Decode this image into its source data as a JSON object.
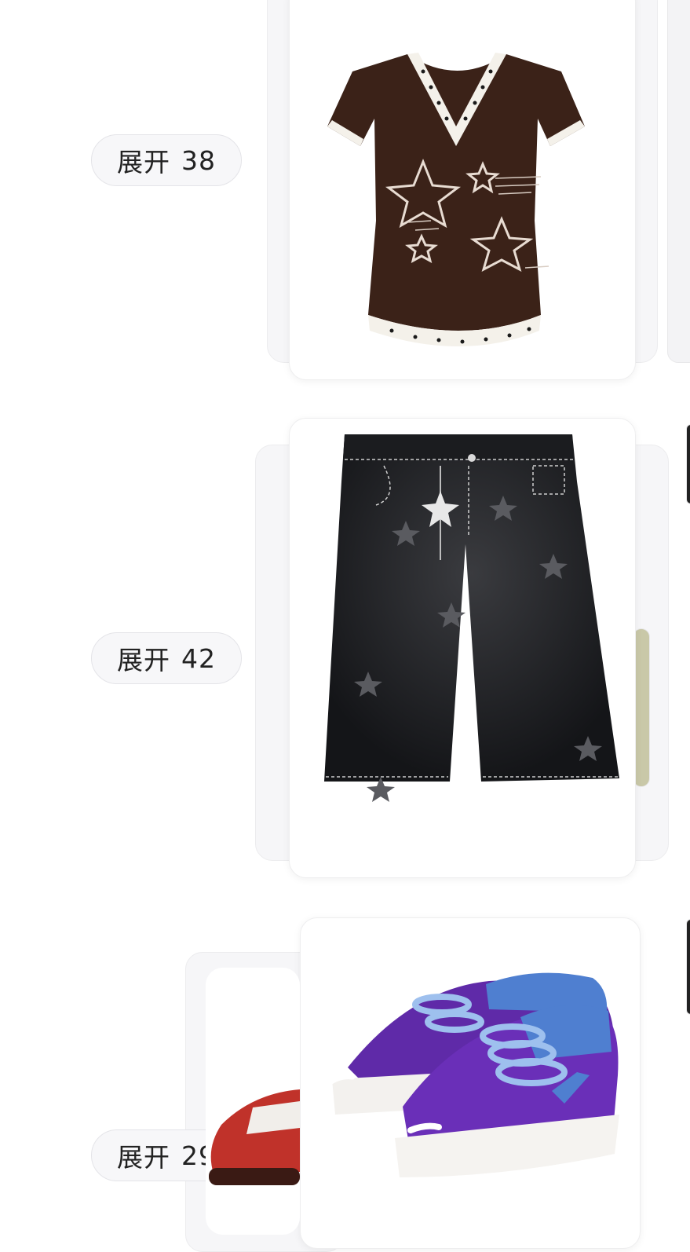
{
  "sections": [
    {
      "expand": {
        "label": "展开",
        "count": "38"
      },
      "product_icon": "brown-v-neck-star-tshirt-icon"
    },
    {
      "expand": {
        "label": "展开",
        "count": "42"
      },
      "product_icon": "black-star-denim-shorts-icon"
    },
    {
      "expand": {
        "label": "展开",
        "count": "29"
      },
      "product_icon": "purple-suede-sneakers-icon"
    }
  ],
  "colors": {
    "tshirt": "#3b2218",
    "tshirt_trim": "#f4f1ea",
    "denim": "#1c1d20",
    "sneaker": "#6a2fb8",
    "sneaker_accent": "#4f7fd0",
    "sneaker_red": "#c0322a"
  }
}
